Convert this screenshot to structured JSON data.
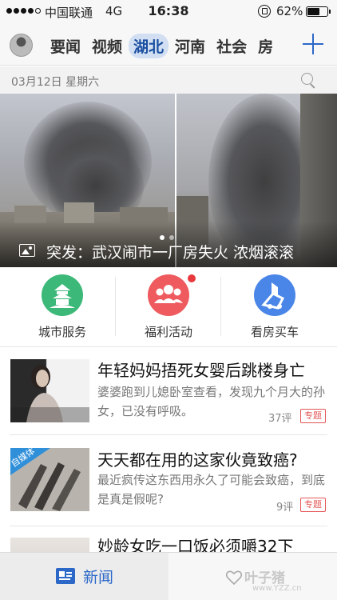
{
  "status_bar": {
    "carrier": "中国联通",
    "network": "4G",
    "time": "16:38",
    "battery": "62%",
    "battery_level": 0.62
  },
  "channel_bar": {
    "tabs": [
      {
        "label": "要闻"
      },
      {
        "label": "视频"
      },
      {
        "label": "湖北",
        "active": true
      },
      {
        "label": "河南"
      },
      {
        "label": "社会"
      },
      {
        "label": "房"
      }
    ],
    "add_icon": "plus-icon"
  },
  "date_bar": {
    "date": "03月12日 星期六",
    "search_icon": "search-icon"
  },
  "hero": {
    "caption": "突发：武汉闹市一厂房失火 浓烟滚滚",
    "icon": "photo-icon",
    "dot_count": 2,
    "active_dot": 0
  },
  "services": [
    {
      "label": "城市服务",
      "icon": "city-pavilion-icon",
      "color": "#3cb878"
    },
    {
      "label": "福利活动",
      "icon": "people-group-icon",
      "color": "#ee5a5e",
      "badge": true
    },
    {
      "label": "看房买车",
      "icon": "house-car-icon",
      "color": "#4a86e8"
    }
  ],
  "news": [
    {
      "title": "年轻妈妈捂死女婴后跳楼身亡",
      "summary": "婆婆跑到儿媳卧室查看，发现九个月大的孙女，已没有呼吸。",
      "comments": "37评",
      "tag": "专题"
    },
    {
      "title": "天天都在用的这家伙竟致癌?",
      "summary": "最近疯传这东西用永久了可能会致癌，到底是真是假呢?",
      "comments": "9评",
      "tag": "专题",
      "thumb_badge": "自媒体"
    },
    {
      "title": "妙龄女吃一口饭必须嚼32下"
    }
  ],
  "bottom_bar": {
    "news_label": "新闻",
    "news_icon": "newspaper-icon",
    "heart_icon": "heart-icon",
    "watermark": "叶子猪",
    "watermark_url": "www.YZZ.cn"
  }
}
